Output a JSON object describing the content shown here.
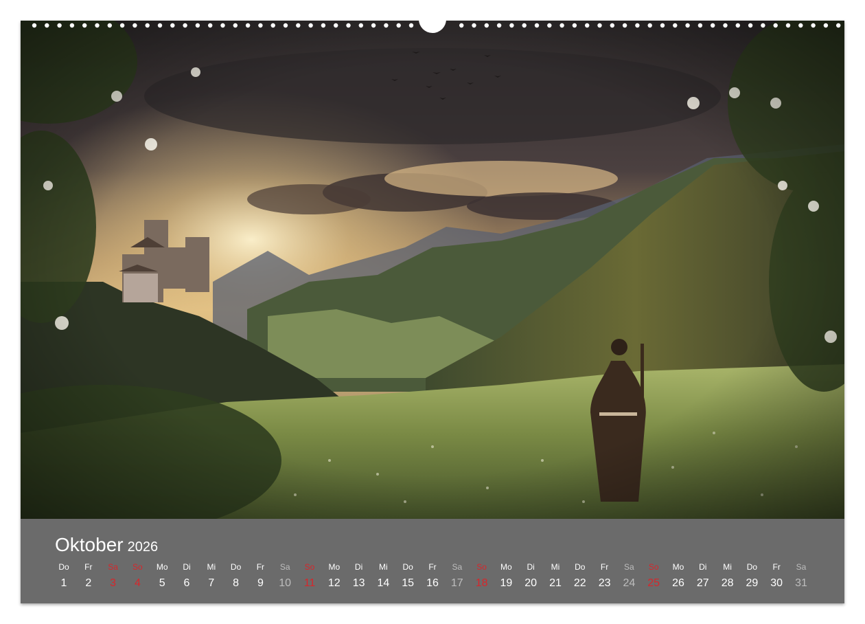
{
  "calendar": {
    "month": "Oktober",
    "year": "2026",
    "days": [
      {
        "weekday": "Do",
        "date": "1",
        "kind": "weekday"
      },
      {
        "weekday": "Fr",
        "date": "2",
        "kind": "weekday"
      },
      {
        "weekday": "Sa",
        "date": "3",
        "kind": "holiday"
      },
      {
        "weekday": "So",
        "date": "4",
        "kind": "sunday"
      },
      {
        "weekday": "Mo",
        "date": "5",
        "kind": "weekday"
      },
      {
        "weekday": "Di",
        "date": "6",
        "kind": "weekday"
      },
      {
        "weekday": "Mi",
        "date": "7",
        "kind": "weekday"
      },
      {
        "weekday": "Do",
        "date": "8",
        "kind": "weekday"
      },
      {
        "weekday": "Fr",
        "date": "9",
        "kind": "weekday"
      },
      {
        "weekday": "Sa",
        "date": "10",
        "kind": "saturday"
      },
      {
        "weekday": "So",
        "date": "11",
        "kind": "sunday"
      },
      {
        "weekday": "Mo",
        "date": "12",
        "kind": "weekday"
      },
      {
        "weekday": "Di",
        "date": "13",
        "kind": "weekday"
      },
      {
        "weekday": "Mi",
        "date": "14",
        "kind": "weekday"
      },
      {
        "weekday": "Do",
        "date": "15",
        "kind": "weekday"
      },
      {
        "weekday": "Fr",
        "date": "16",
        "kind": "weekday"
      },
      {
        "weekday": "Sa",
        "date": "17",
        "kind": "saturday"
      },
      {
        "weekday": "So",
        "date": "18",
        "kind": "sunday"
      },
      {
        "weekday": "Mo",
        "date": "19",
        "kind": "weekday"
      },
      {
        "weekday": "Di",
        "date": "20",
        "kind": "weekday"
      },
      {
        "weekday": "Mi",
        "date": "21",
        "kind": "weekday"
      },
      {
        "weekday": "Do",
        "date": "22",
        "kind": "weekday"
      },
      {
        "weekday": "Fr",
        "date": "23",
        "kind": "weekday"
      },
      {
        "weekday": "Sa",
        "date": "24",
        "kind": "saturday"
      },
      {
        "weekday": "So",
        "date": "25",
        "kind": "sunday"
      },
      {
        "weekday": "Mo",
        "date": "26",
        "kind": "weekday"
      },
      {
        "weekday": "Di",
        "date": "27",
        "kind": "weekday"
      },
      {
        "weekday": "Mi",
        "date": "28",
        "kind": "weekday"
      },
      {
        "weekday": "Do",
        "date": "29",
        "kind": "weekday"
      },
      {
        "weekday": "Fr",
        "date": "30",
        "kind": "weekday"
      },
      {
        "weekday": "Sa",
        "date": "31",
        "kind": "saturday"
      }
    ]
  },
  "colors": {
    "band": "#6b6b6b",
    "text": "#ffffff",
    "saturday": "#bdbdbd",
    "sunday_holiday": "#d7262b"
  }
}
